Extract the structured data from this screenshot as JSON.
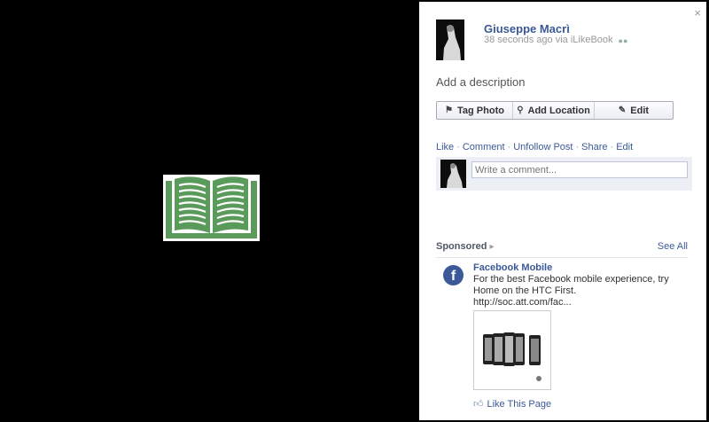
{
  "photo": {
    "icon": "open-book-icon",
    "accent": "#5a9a5a"
  },
  "panel": {
    "close_icon": "×",
    "owner": {
      "name": "Giuseppe Macrì",
      "meta": "38 seconds ago via iLikeBook",
      "audience_icon": "friends-icon"
    },
    "description_placeholder": "Add a description",
    "actions": [
      {
        "label": "Tag Photo",
        "icon": "tag-icon"
      },
      {
        "label": "Add Location",
        "icon": "location-pin-icon"
      },
      {
        "label": "Edit",
        "icon": "pencil-icon"
      }
    ],
    "ufi_links": [
      "Like",
      "Comment",
      "Unfollow Post",
      "Share",
      "Edit"
    ],
    "comment_placeholder": "Write a comment...",
    "sponsored": {
      "title": "Sponsored",
      "see_all": "See All",
      "ad": {
        "name": "Facebook Mobile",
        "body": "For the best Facebook mobile experience, try Home on the HTC First.",
        "url": "http://soc.att.com/fac...",
        "like_label": "Like This Page"
      }
    }
  },
  "colors": {
    "link": "#3b5998",
    "panel_bg": "#ffffff",
    "stage_bg": "#000000"
  }
}
